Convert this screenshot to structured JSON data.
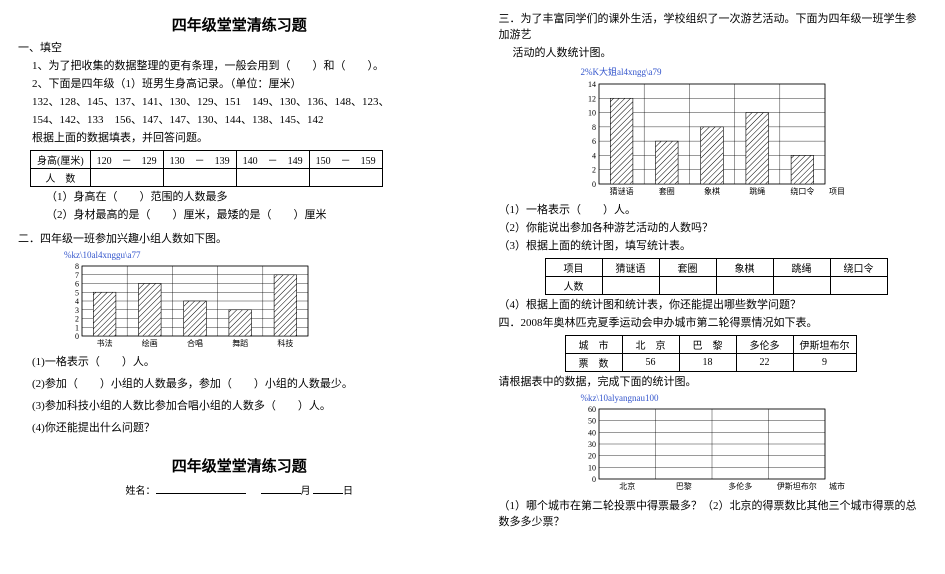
{
  "left": {
    "title": "四年级堂堂清练习题",
    "sec1_header": "一、填空",
    "q1": "1、为了把收集的数据整理的更有条理，一般会用到（　　）和（　　）。",
    "q2_a": "2、下面是四年级（1）班男生身高记录。（单位：厘米）",
    "q2_b": "132、128、145、137、141、130、129、151　149、130、136、148、123、",
    "q2_c": "154、142、133　156、147、147、130、144、138、145、142",
    "q2_d": "根据上面的数据填表，并回答问题。",
    "table1": {
      "r1": [
        "身高(厘米)",
        "120　－　129",
        "130　－　139",
        "140　－　149",
        "150　－　159"
      ],
      "r2": [
        "人　数",
        "",
        "",
        "",
        ""
      ]
    },
    "q2_e": "（1）身高在（　　）范围的人数最多",
    "q2_f": "（2）身材最高的是（　　）厘米，最矮的是（　　）厘米",
    "sec2_header": "二．四年级一班参加兴趣小组人数如下图。",
    "chart2_caption": "%kz\\10al4xnggu\\a77",
    "s2_q1": "(1)一格表示（　　）人。",
    "s2_q2": "(2)参加（　　）小组的人数最多，参加（　　）小组的人数最少。",
    "s2_q3": "(3)参加科技小组的人数比参加合唱小组的人数多（　　）人。",
    "s2_q4": "(4)你还能提出什么问题？",
    "title2": "四年级堂堂清练习题",
    "footer_name": "姓名：",
    "footer_month": "月",
    "footer_day": "日"
  },
  "right": {
    "sec3_a": "三．为了丰富同学们的课外生活，学校组织了一次游艺活动。下面为四年级一班学生参加游艺",
    "sec3_b": "活动的人数统计图。",
    "chart3_caption": "2%K大姐al4xngg\\a79",
    "s3_q1": "（1）一格表示（　　）人。",
    "s3_q2": "（2）你能说出参加各种游艺活动的人数吗？",
    "s3_q3": "（3）根据上面的统计图，填写统计表。",
    "table3": {
      "head": [
        "项目",
        "猜谜语",
        "套圈",
        "象棋",
        "跳绳",
        "绕口令"
      ],
      "row": [
        "人数",
        "",
        "",
        "",
        "",
        ""
      ]
    },
    "s3_q4": "（4）根据上面的统计图和统计表，你还能提出哪些数学问题？",
    "sec4_a": "四．2008年奥林匹克夏季运动会申办城市第二轮得票情况如下表。",
    "table4": {
      "head": [
        "城　市",
        "北　京",
        "巴　黎",
        "多伦多",
        "伊斯坦布尔"
      ],
      "row": [
        "票　数",
        "56",
        "18",
        "22",
        "9"
      ]
    },
    "s4_a": "请根据表中的数据，完成下面的统计图。",
    "chart4_caption": "%kz\\10alyangnau100",
    "s4_q": "（1）哪个城市在第二轮投票中得票最多？（2）北京的得票数比其他三个城市得票的总数多多少票？"
  },
  "chart_data": [
    {
      "type": "bar",
      "id": "chart-interest-groups",
      "categories": [
        "书法",
        "绘画",
        "合唱",
        "舞蹈",
        "科技"
      ],
      "values": [
        5,
        6,
        4,
        3,
        7
      ],
      "ylim": [
        0,
        8
      ],
      "ytick": 1,
      "pattern": "hatch",
      "xlabel": "",
      "ylabel": ""
    },
    {
      "type": "bar",
      "id": "chart-activities",
      "categories": [
        "猜谜语",
        "套圈",
        "象棋",
        "跳绳",
        "绕口令"
      ],
      "values": [
        12,
        6,
        8,
        10,
        4
      ],
      "ylim": [
        0,
        14
      ],
      "ytick": 2,
      "pattern": "hatch",
      "xlabel": "项目",
      "ylabel": ""
    },
    {
      "type": "bar",
      "id": "chart-votes-blank",
      "categories": [
        "北京",
        "巴黎",
        "多伦多",
        "伊斯坦布尔"
      ],
      "values": [
        0,
        0,
        0,
        0
      ],
      "ylim": [
        0,
        60
      ],
      "ytick": 10,
      "pattern": "none",
      "xlabel": "城市",
      "ylabel": ""
    }
  ]
}
